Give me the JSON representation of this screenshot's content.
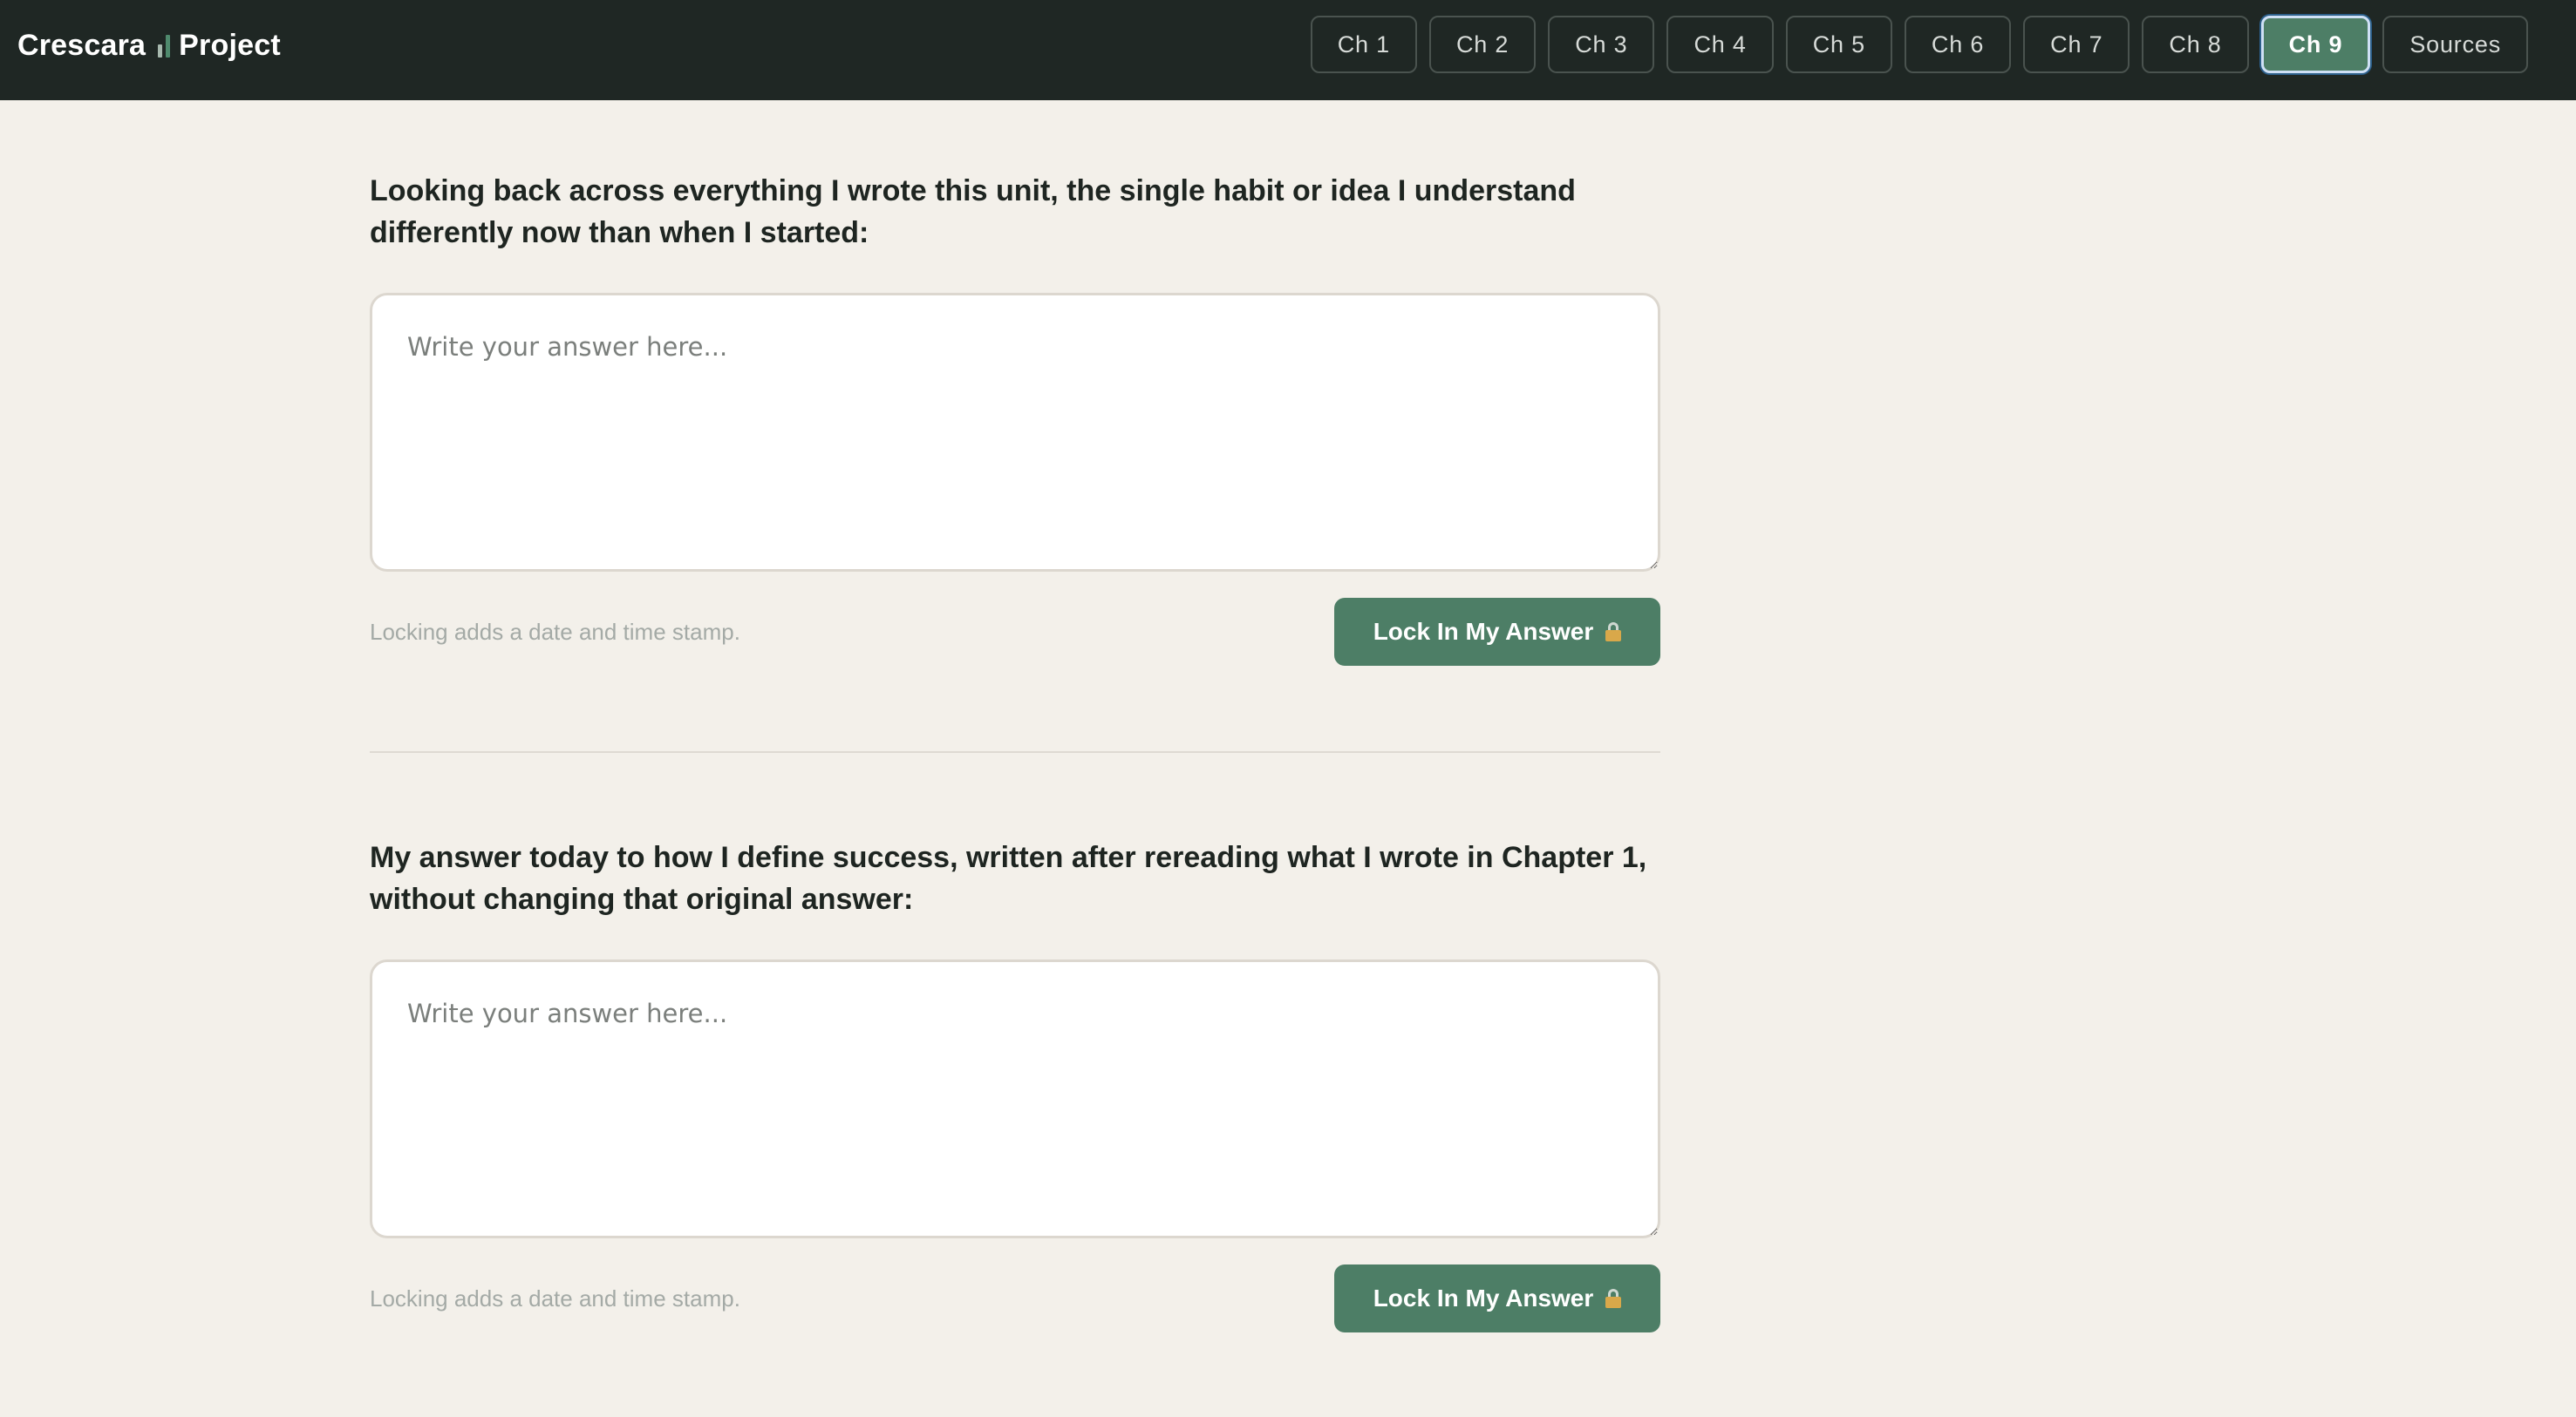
{
  "brand": {
    "name_left": "Crescara",
    "name_right": "Project"
  },
  "nav": {
    "items": [
      {
        "label": "Ch 1",
        "active": false
      },
      {
        "label": "Ch 2",
        "active": false
      },
      {
        "label": "Ch 3",
        "active": false
      },
      {
        "label": "Ch 4",
        "active": false
      },
      {
        "label": "Ch 5",
        "active": false
      },
      {
        "label": "Ch 6",
        "active": false
      },
      {
        "label": "Ch 7",
        "active": false
      },
      {
        "label": "Ch 8",
        "active": false
      },
      {
        "label": "Ch 9",
        "active": true
      },
      {
        "label": "Sources",
        "active": false
      }
    ]
  },
  "questions": [
    {
      "prompt": "Looking back across everything I wrote this unit, the single habit or idea I understand differently now than when I started:",
      "placeholder": "Write your answer here...",
      "value": "",
      "note": "Locking adds a date and time stamp.",
      "button_label": "Lock In My Answer"
    },
    {
      "prompt": "My answer today to how I define success, written after rereading what I wrote in Chapter 1, without changing that original answer:",
      "placeholder": "Write your answer here...",
      "value": "",
      "note": "Locking adds a date and time stamp.",
      "button_label": "Lock In My Answer"
    }
  ],
  "colors": {
    "topbar": "#1f2724",
    "page_background": "#f3f0ea",
    "accent_green": "#4d7e66",
    "active_focus_ring": "#cfe0f5"
  },
  "icons": {
    "brand_mark": "bar-chart-icon",
    "lock": "lock-icon"
  }
}
